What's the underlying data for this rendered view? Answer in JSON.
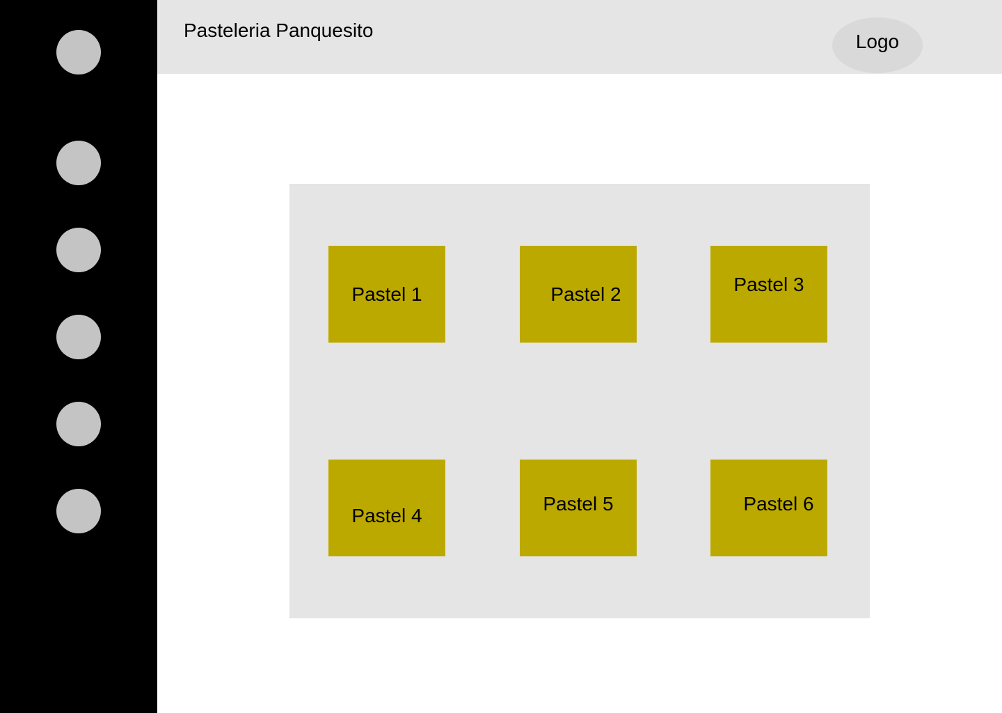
{
  "header": {
    "title": "Pasteleria Panquesito",
    "logo_label": "Logo"
  },
  "sidebar": {
    "items": [
      {
        "icon": "circle-placeholder"
      },
      {
        "icon": "circle-placeholder"
      },
      {
        "icon": "circle-placeholder"
      },
      {
        "icon": "circle-placeholder"
      },
      {
        "icon": "circle-placeholder"
      },
      {
        "icon": "circle-placeholder"
      }
    ]
  },
  "products": [
    {
      "label": "Pastel 1"
    },
    {
      "label": "Pastel 2"
    },
    {
      "label": "Pastel 3"
    },
    {
      "label": "Pastel 4"
    },
    {
      "label": "Pastel 5"
    },
    {
      "label": "Pastel 6"
    }
  ],
  "colors": {
    "sidebar_bg": "#000000",
    "header_bg": "#e5e5e5",
    "nav_dot": "#c4c4c4",
    "logo_bg": "#d9d9d9",
    "panel_bg": "#e5e5e5",
    "card_bg": "#bca900"
  }
}
